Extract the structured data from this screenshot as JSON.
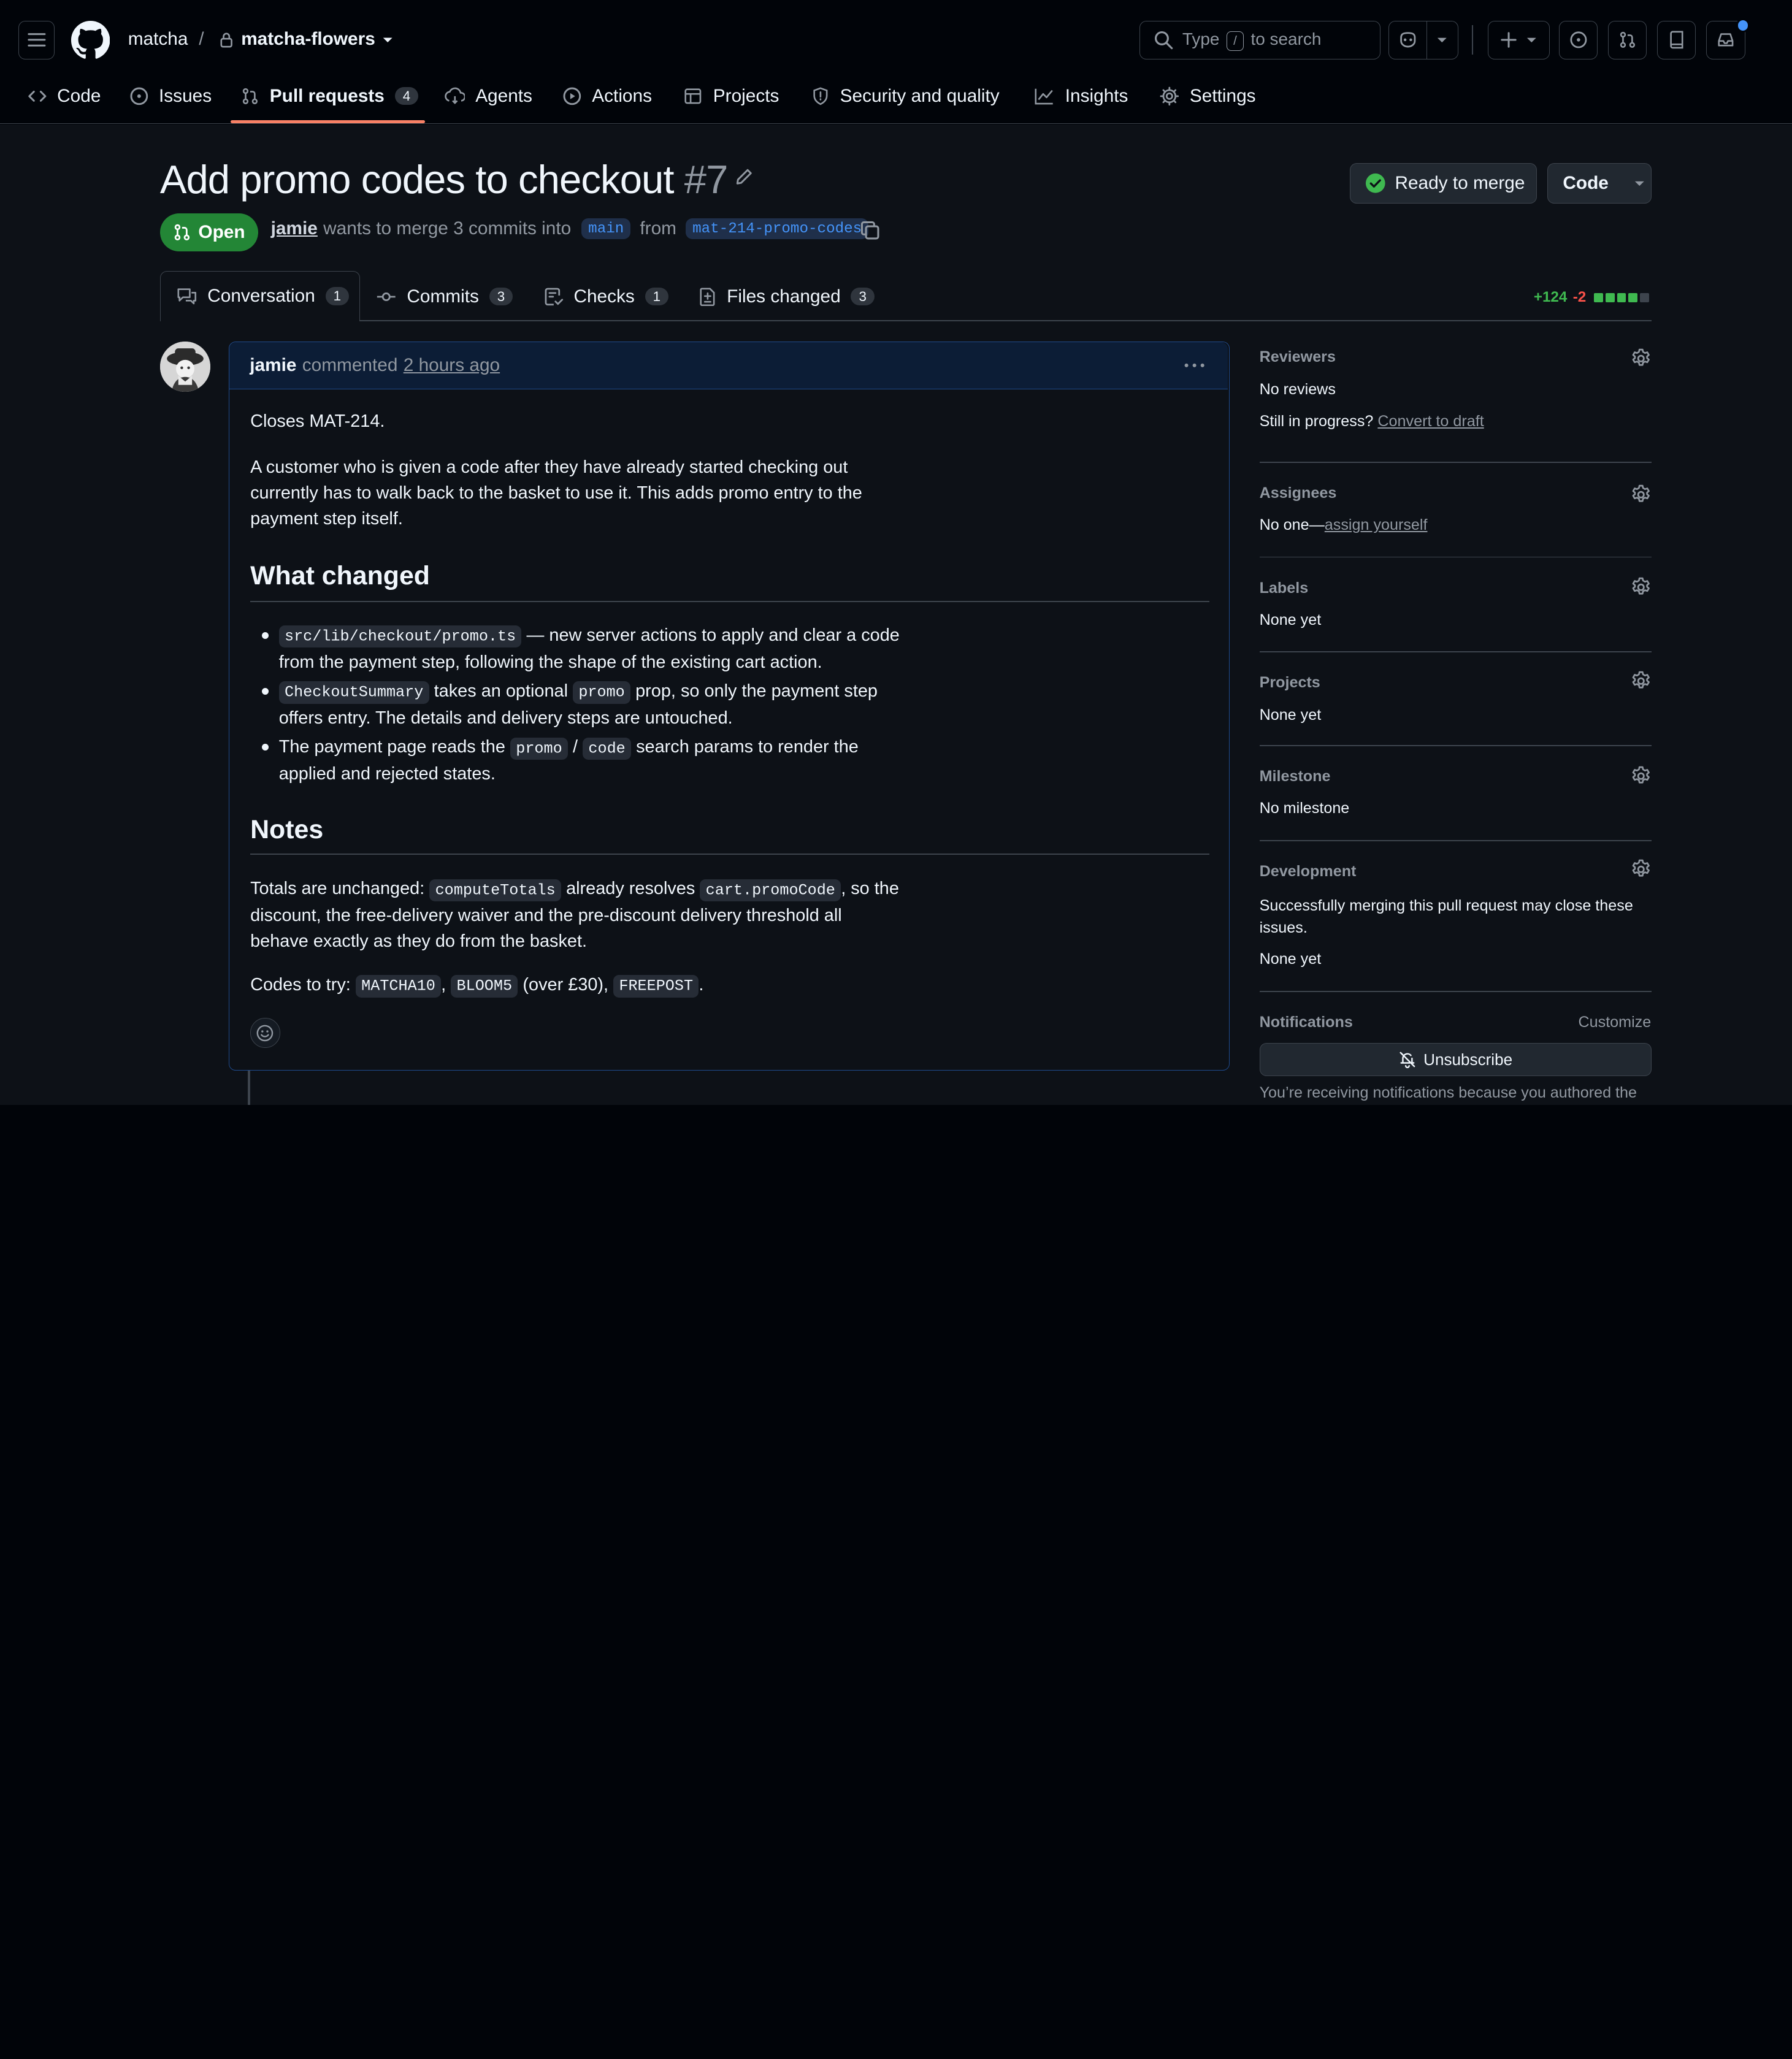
{
  "header": {
    "owner": "matcha",
    "separator": "/",
    "repo": "matcha-flowers",
    "search_prefix": "Type",
    "search_key": "/",
    "search_suffix": "to search"
  },
  "nav": {
    "items": [
      {
        "label": "Code"
      },
      {
        "label": "Issues"
      },
      {
        "label": "Pull requests",
        "count": "4"
      },
      {
        "label": "Agents"
      },
      {
        "label": "Actions"
      },
      {
        "label": "Projects"
      },
      {
        "label": "Security and quality"
      },
      {
        "label": "Insights"
      },
      {
        "label": "Settings"
      }
    ]
  },
  "pr": {
    "title": "Add promo codes to checkout",
    "number": "#7",
    "state": "Open",
    "author": "jamie",
    "merge_text": "wants to merge 3 commits into",
    "base_branch": "main",
    "from_text": "from",
    "head_branch": "mat-214-promo-codes",
    "ready_label": "Ready to merge",
    "code_label": "Code",
    "additions": "+124",
    "deletions": "-2"
  },
  "tabs": [
    {
      "label": "Conversation",
      "count": "1"
    },
    {
      "label": "Commits",
      "count": "3"
    },
    {
      "label": "Checks",
      "count": "1"
    },
    {
      "label": "Files changed",
      "count": "3"
    }
  ],
  "comment": {
    "author": "jamie",
    "action": "commented",
    "time": "2 hours ago",
    "p1": "Closes MAT-214.",
    "p2_l1": "A customer who is given a code after they have already started checking out",
    "p2_l2": "currently has to walk back to the basket to use it. This adds promo entry to the",
    "p2_l3": "payment step itself.",
    "h_changed": "What changed",
    "b1_code": "src/lib/checkout/promo.ts",
    "b1_l1": "— new server actions to apply and clear a code",
    "b1_l2": "from the payment step, following the shape of the existing cart action.",
    "b2_code": "CheckoutSummary",
    "b2_mid": "takes an optional",
    "b2_code2": "promo",
    "b2_l1": "prop, so only the payment step",
    "b2_l2": "offers entry. The details and delivery steps are untouched.",
    "b3_pre": "The payment page reads the",
    "b3_code": "promo",
    "b3_slash": "/",
    "b3_code2": "code",
    "b3_l1": "search params to render the",
    "b3_l2": "applied and rejected states.",
    "h_notes": "Notes",
    "n1_pre": "Totals are unchanged:",
    "n1_code": "computeTotals",
    "n1_mid": "already resolves",
    "n1_code2": "cart.promoCode",
    "n1_l1": ", so the",
    "n1_l2": "discount, the free-delivery waiver and the pre-discount delivery threshold all",
    "n1_l3": "behave exactly as they do from the basket.",
    "n2_pre": "Codes to try:",
    "n2_c1": "MATCHA10",
    "n2_comma": ",",
    "n2_c2": "BLOOM5",
    "n2_mid": "(over £30),",
    "n2_c3": "FREEPOST",
    "n2_end": "."
  },
  "sidebar": {
    "reviewers_h": "Reviewers",
    "reviewers_v": "No reviews",
    "draft_q": "Still in progress?",
    "draft_link": "Convert to draft",
    "assignees_h": "Assignees",
    "assignees_v": "No one—",
    "assign_link": "assign yourself",
    "labels_h": "Labels",
    "labels_v": "None yet",
    "projects_h": "Projects",
    "projects_v": "None yet",
    "milestone_h": "Milestone",
    "milestone_v": "No milestone",
    "dev_h": "Development",
    "dev_l1": "Successfully merging this pull request may close these",
    "dev_l2": "issues.",
    "dev_v": "None yet",
    "notif_h": "Notifications",
    "customize": "Customize",
    "unsubscribe": "Unsubscribe",
    "notif_reason": "You’re receiving notifications because you authored the"
  },
  "colors": {
    "accent": "#4493f8",
    "open_green": "#238636",
    "tab_underline": "#f78166",
    "additions": "#3fb950",
    "deletions": "#f85149"
  }
}
